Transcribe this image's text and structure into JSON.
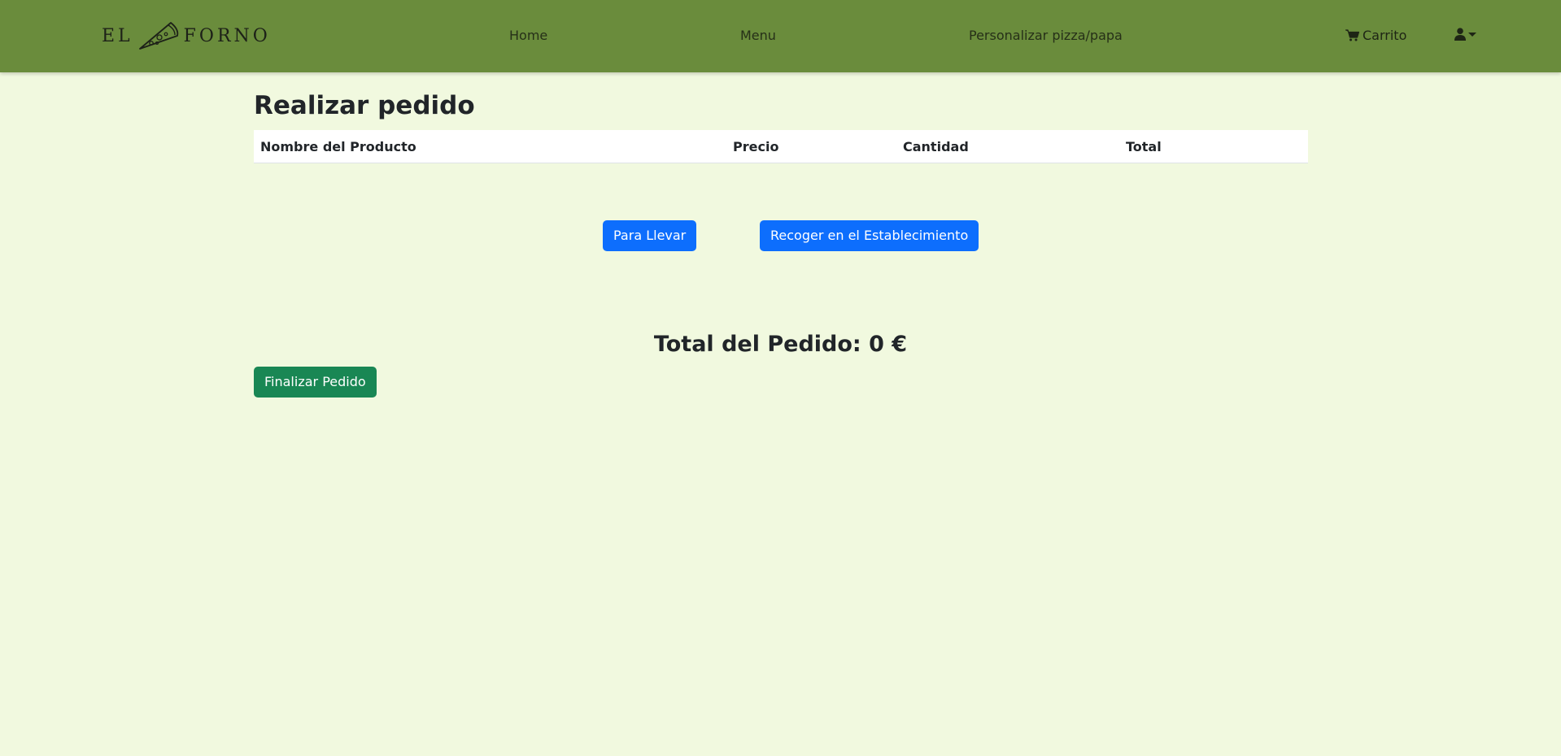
{
  "brand": {
    "left": "EL",
    "right": "FORNO",
    "logo_icon": "pizza-slice-icon"
  },
  "nav": {
    "items": [
      {
        "label": "Home"
      },
      {
        "label": "Menu"
      },
      {
        "label": "Personalizar pizza/papa"
      }
    ],
    "cart": {
      "label": "Carrito",
      "icon": "cart-icon"
    },
    "user": {
      "icon": "user-icon"
    }
  },
  "colors": {
    "navbar": "#6a8c3c",
    "page_background": "#f1f9df",
    "primary": "#0d6efd",
    "success": "#198754"
  },
  "main": {
    "title": "Realizar pedido",
    "table": {
      "headers": [
        "Nombre del Producto",
        "Precio",
        "Cantidad",
        "Total"
      ],
      "rows": []
    },
    "delivery_options": [
      {
        "label": "Para Llevar"
      },
      {
        "label": "Recoger en el Establecimiento"
      }
    ],
    "total_text": "Total del Pedido: 0 €",
    "finalize_label": "Finalizar Pedido"
  }
}
